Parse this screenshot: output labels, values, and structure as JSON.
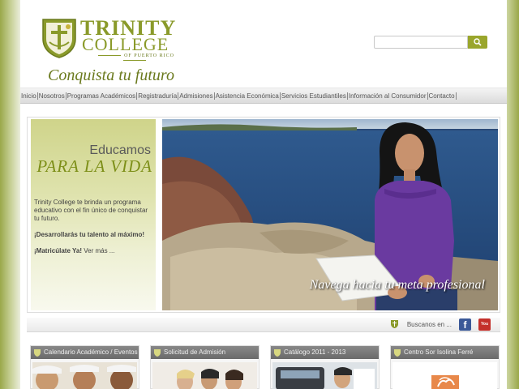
{
  "header": {
    "logo_word1": "TRINITY",
    "logo_word2": "COLLEGE",
    "logo_sub": "OF PUERTO RICO",
    "slogan": "Conquista tu futuro",
    "search_placeholder": "",
    "search_value": ""
  },
  "nav": {
    "items": [
      {
        "label": "Inicio"
      },
      {
        "label": "Nosotros"
      },
      {
        "label": "Programas Académicos"
      },
      {
        "label": "Registraduría"
      },
      {
        "label": "Admisiones"
      },
      {
        "label": "Asistencia Económica"
      },
      {
        "label": "Servicios Estudiantiles"
      },
      {
        "label": "Información al Consumidor"
      },
      {
        "label": "Contacto"
      }
    ]
  },
  "promo": {
    "heading1": "Educamos",
    "heading2": "PARA LA VIDA",
    "text": "Trinity College te brinda un programa educativo con el fin único de conquistar tu futuro.",
    "bold_line": "¡Desarrollarás tu talento al máximo!",
    "cta_bold": "¡Matricúlate Ya!",
    "cta_link": "Ver más ..."
  },
  "hero": {
    "caption": "Navega hacia tu meta profesional"
  },
  "social": {
    "label": "Buscanos en ...",
    "facebook_glyph": "f",
    "youtube_glyph": "You Tube"
  },
  "boxes": [
    {
      "title": "Calendario Académico / Eventos"
    },
    {
      "title": "Solicitud de Admisión"
    },
    {
      "title": "Catálogo 2011 - 2013"
    },
    {
      "title": "Centro Sor Isolina Ferré"
    }
  ],
  "colors": {
    "brand_green": "#8a9a2a",
    "accent_dark_green": "#6b7a1e",
    "box_header_gray": "#777777"
  }
}
